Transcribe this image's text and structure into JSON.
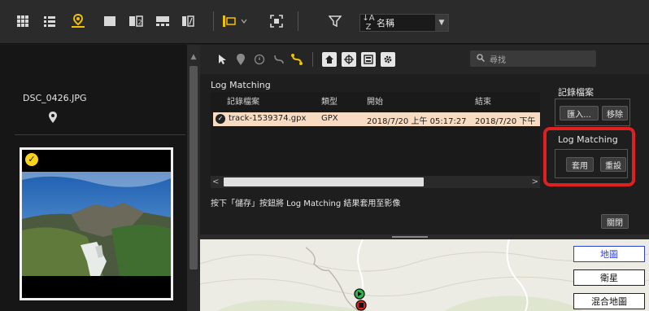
{
  "toolbar": {
    "icons": [
      "grid-icon",
      "list-icon",
      "map-pin-icon",
      "single-view-icon",
      "compare-icon",
      "filmstrip-icon",
      "split-icon",
      "label-filter-icon",
      "fullscreen-icon",
      "filter-icon"
    ],
    "sort_label": "名稱",
    "sort_icon_text": "↓A Z"
  },
  "left": {
    "filename": "DSC_0426.JPG",
    "check": "✓"
  },
  "subtoolbar": {
    "search_placeholder": "尋找"
  },
  "log_matching": {
    "title": "Log Matching",
    "columns": [
      "記錄檔案",
      "類型",
      "開始",
      "結束"
    ],
    "rows": [
      {
        "file": "track-1539374.gpx",
        "type": "GPX",
        "start": "2018/7/20 上午 05:17:27",
        "end": "2018/7/20 下午"
      }
    ]
  },
  "log_file_panel": {
    "title": "記錄檔案",
    "import_label": "匯入...",
    "remove_label": "移除"
  },
  "log_matching_panel": {
    "title": "Log Matching",
    "apply_label": "套用",
    "reset_label": "重設"
  },
  "hint": "按下「儲存」按鈕將 Log Matching 結果套用至影像",
  "close_label": "關閉",
  "map": {
    "buttons": [
      "地圖",
      "衛星",
      "混合地圖"
    ]
  },
  "colors": {
    "accent": "#f2c200",
    "highlight_frame": "#e0201e",
    "row_highlight": "#f7dcc3",
    "map_active": "#2b41d6"
  }
}
